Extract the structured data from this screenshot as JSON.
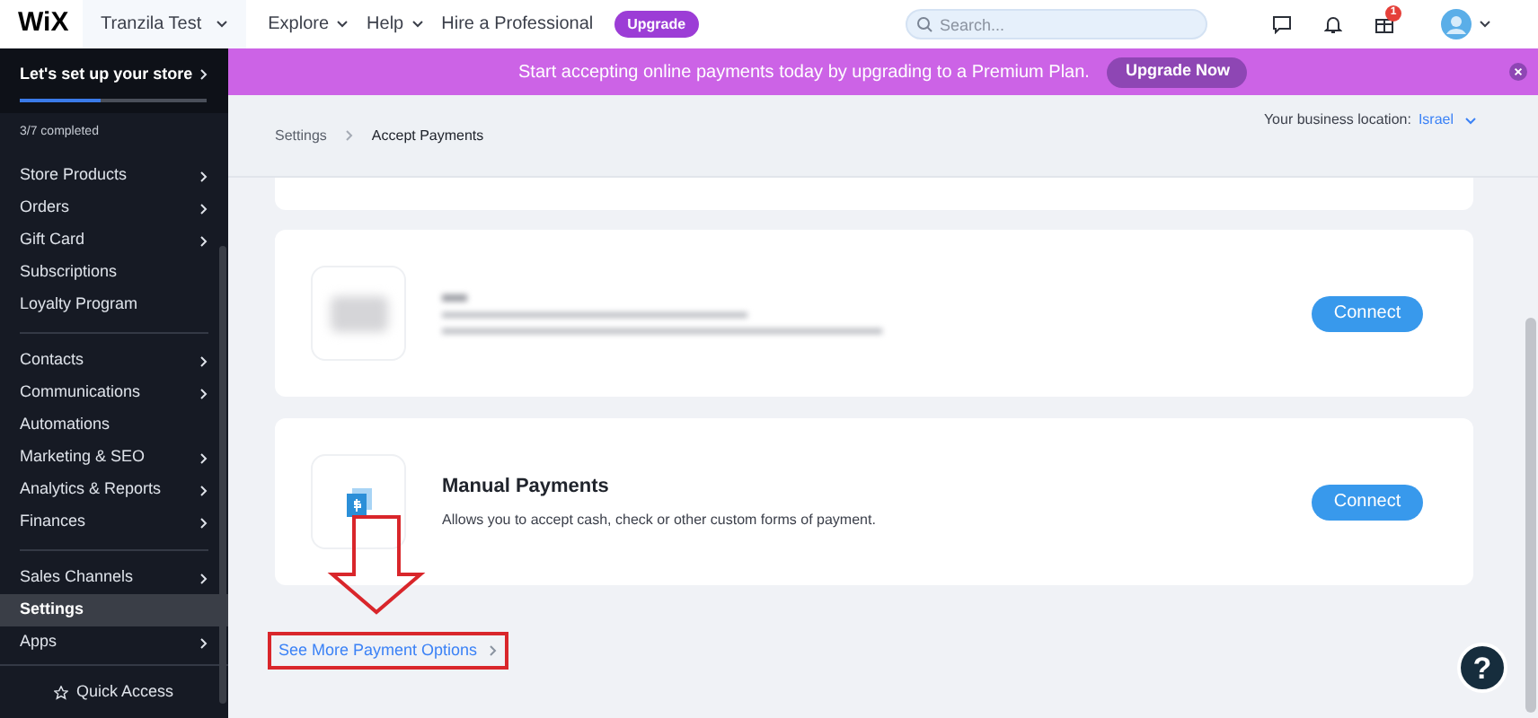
{
  "topbar": {
    "logo": "WiX",
    "site": "Tranzila Test",
    "menus": [
      {
        "label": "Explore",
        "dropdown": true
      },
      {
        "label": "Help",
        "dropdown": true
      },
      {
        "label": "Hire a Professional",
        "dropdown": false
      }
    ],
    "upgrade": "Upgrade",
    "search": {
      "placeholder": "Search..."
    },
    "notification_count": "1"
  },
  "banner": {
    "text": "Start accepting online payments today by upgrading to a Premium Plan.",
    "button": "Upgrade Now"
  },
  "sidebar": {
    "setup": {
      "title": "Let's set up your store",
      "level": 0.43,
      "progress": "3/7 completed"
    },
    "groups": [
      [
        {
          "label": "Store Products",
          "arrow": true,
          "selected": false
        },
        {
          "label": "Orders",
          "arrow": true,
          "selected": false
        },
        {
          "label": "Gift Card",
          "arrow": true,
          "selected": false
        },
        {
          "label": "Subscriptions",
          "arrow": false,
          "selected": false
        },
        {
          "label": "Loyalty Program",
          "arrow": false,
          "selected": false
        }
      ],
      [
        {
          "label": "Contacts",
          "arrow": true,
          "selected": false
        },
        {
          "label": "Communications",
          "arrow": true,
          "selected": false
        },
        {
          "label": "Automations",
          "arrow": false,
          "selected": false
        },
        {
          "label": "Marketing & SEO",
          "arrow": true,
          "selected": false
        },
        {
          "label": "Analytics & Reports",
          "arrow": true,
          "selected": false
        },
        {
          "label": "Finances",
          "arrow": true,
          "selected": false
        }
      ],
      [
        {
          "label": "Sales Channels",
          "arrow": true,
          "selected": false
        },
        {
          "label": "Settings",
          "arrow": false,
          "selected": true
        },
        {
          "label": "Apps",
          "arrow": true,
          "selected": false
        }
      ]
    ],
    "quick_access": "Quick Access"
  },
  "breadcrumb": [
    "Settings",
    "Accept Payments"
  ],
  "location": {
    "label": "Your business location:",
    "value": "Israel"
  },
  "providers": [
    {
      "kind": "blurred",
      "button": "Connect"
    },
    {
      "kind": "manual",
      "title": "Manual Payments",
      "description": "Allows you to accept cash, check or other custom forms of payment.",
      "button": "Connect"
    }
  ],
  "more_link": "See More Payment Options",
  "help": "?"
}
